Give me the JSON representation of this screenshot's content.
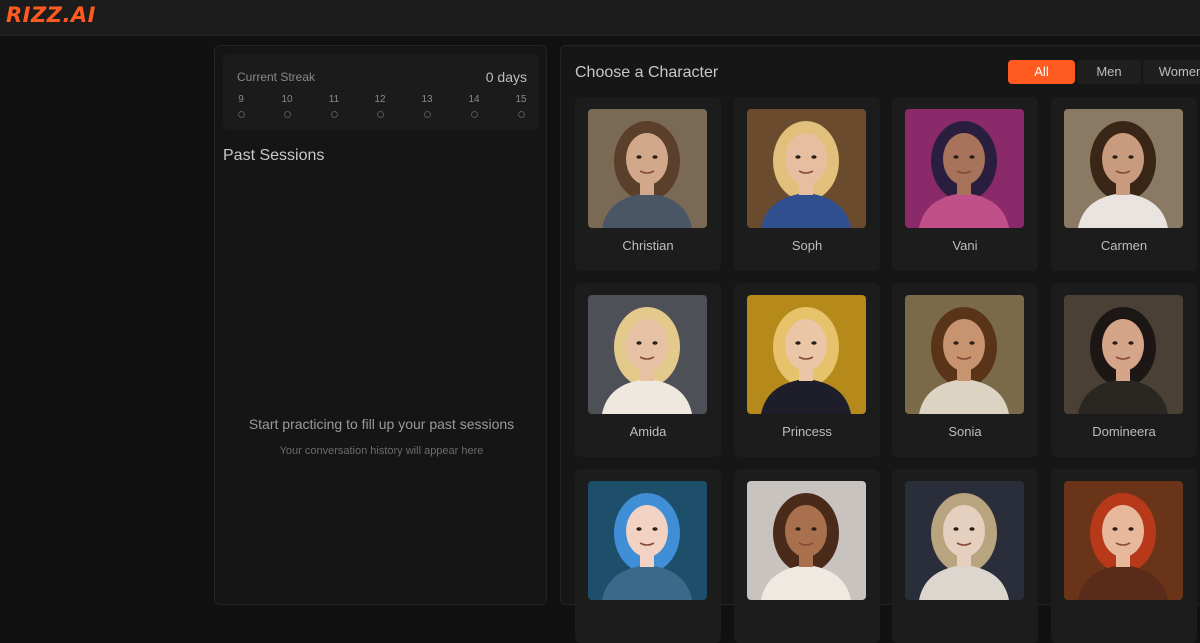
{
  "header": {
    "logo": "RIZZ.AI"
  },
  "streak": {
    "label": "Current Streak",
    "value": "0 days",
    "days": [
      "9",
      "10",
      "11",
      "12",
      "13",
      "14",
      "15"
    ]
  },
  "past_sessions": {
    "title": "Past Sessions",
    "empty_title": "Start practicing to fill up your past sessions",
    "empty_sub": "Your conversation history will appear here"
  },
  "characters": {
    "title": "Choose a Character",
    "filters": [
      "All",
      "Men",
      "Women"
    ],
    "items": [
      {
        "name": "Christian",
        "bg": "#7a6a55",
        "hair": "#5a3f2a",
        "skin": "#d2a88a",
        "cloth": "#4a5566"
      },
      {
        "name": "Soph",
        "bg": "#6a4b2e",
        "hair": "#e0c07a",
        "skin": "#e7bfa0",
        "cloth": "#2f4f8f"
      },
      {
        "name": "Vani",
        "bg": "#8a2a6a",
        "hair": "#2a1e3e",
        "skin": "#a7735a",
        "cloth": "#c0508a"
      },
      {
        "name": "Carmen",
        "bg": "#8a7a64",
        "hair": "#3a2616",
        "skin": "#c99b7e",
        "cloth": "#e9e4e0"
      },
      {
        "name": "Amida",
        "bg": "#4e5058",
        "hair": "#e3c98c",
        "skin": "#e6c1a4",
        "cloth": "#eee8de"
      },
      {
        "name": "Princess",
        "bg": "#b58a1a",
        "hair": "#e6c36a",
        "skin": "#eac5a6",
        "cloth": "#1e1e2a"
      },
      {
        "name": "Sonia",
        "bg": "#7a6a4a",
        "hair": "#5a3418",
        "skin": "#c8946f",
        "cloth": "#ddd3c3"
      },
      {
        "name": "Domineera",
        "bg": "#4a4036",
        "hair": "#1c1614",
        "skin": "#d4a589",
        "cloth": "#2a2622"
      },
      {
        "name": "",
        "bg": "#1e4f6a",
        "hair": "#3f8ed6",
        "skin": "#f1d2c3",
        "cloth": "#3a6a8a"
      },
      {
        "name": "",
        "bg": "#c9c3c0",
        "hair": "#4a2a18",
        "skin": "#a9704e",
        "cloth": "#efe9e2"
      },
      {
        "name": "",
        "bg": "#2a2e3a",
        "hair": "#b8a47e",
        "skin": "#e5cfbf",
        "cloth": "#dcd6ce"
      },
      {
        "name": "",
        "bg": "#6a3418",
        "hair": "#b8381a",
        "skin": "#e8b89a",
        "cloth": "#5a2a1a"
      }
    ]
  }
}
